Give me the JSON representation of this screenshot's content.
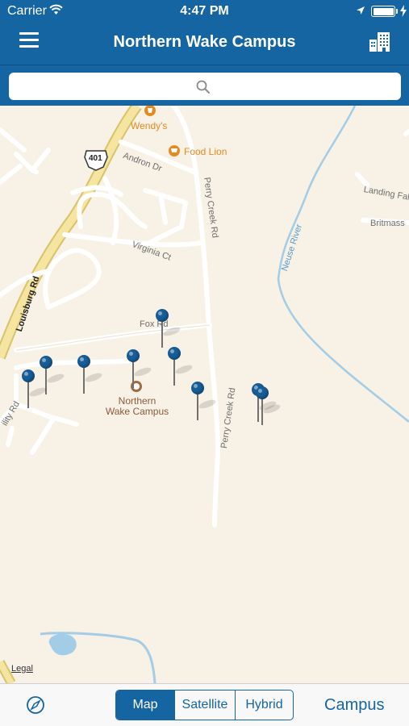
{
  "status_bar": {
    "carrier": "Carrier",
    "time": "4:47 PM",
    "icons": [
      "wifi-icon",
      "location-arrow-icon",
      "battery-icon",
      "charging-bolt-icon"
    ]
  },
  "nav": {
    "title": "Northern Wake Campus",
    "left_icon": "hamburger-menu-icon",
    "right_icon": "building-icon"
  },
  "search": {
    "placeholder": "",
    "icon": "search-icon"
  },
  "map": {
    "road_labels": {
      "louisburg": "Louisburg Rd",
      "andron": "Andron Dr",
      "perry_creek_top": "Perry Creek Rd",
      "virginia": "Virginia Ct",
      "fox": "Fox Rd",
      "perry_creek_bottom": "Perry Creek Rd",
      "neuse": "Neuse River",
      "landing": "Landing Fal",
      "britmass": "Britmass",
      "ability": "ility Rd",
      "highway_shield": "401"
    },
    "pois": {
      "wendys": "Wendy's",
      "food_lion": "Food Lion"
    },
    "campus_label": "Northern Wake Campus",
    "legal": "Legal",
    "pin_count": 10,
    "colors": {
      "land": "#f7f1e6",
      "road": "#ffffff",
      "highway": "#f2dc8a",
      "water": "#a3cce6",
      "pin": "#175e98",
      "poi": "#e58a1e"
    }
  },
  "bottom_bar": {
    "compass_icon": "compass-icon",
    "segments": [
      "Map",
      "Satellite",
      "Hybrid"
    ],
    "selected_segment": "Map",
    "campus_button": "Campus",
    "accent": "#1565a3"
  }
}
